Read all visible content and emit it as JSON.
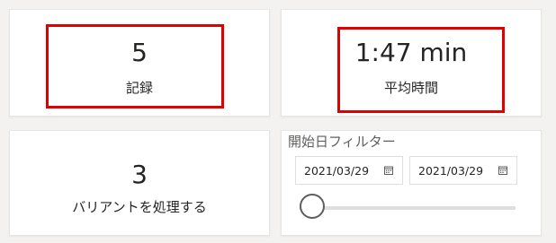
{
  "records": {
    "value": "5",
    "label": "記録"
  },
  "average_time": {
    "value": "1:47 min",
    "label": "平均時間"
  },
  "variants": {
    "value": "3",
    "label": "バリアントを処理する"
  },
  "start_date_filter": {
    "title": "開始日フィルター",
    "start_date": "2021/03/29",
    "end_date": "2021/03/29",
    "start_icon": "calendar-icon",
    "end_icon": "calendar-icon",
    "slider_position": 0
  },
  "colors": {
    "highlight": "#e00000",
    "card_background": "#ffffff",
    "page_background": "#f3f2f1"
  }
}
